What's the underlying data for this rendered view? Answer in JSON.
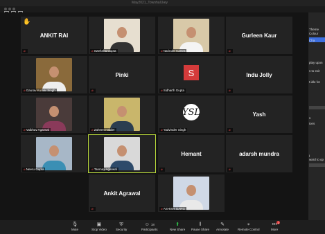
{
  "window": {
    "title": "May2021_Townhall.key"
  },
  "participants": [
    {
      "name": "ANKIT RAI",
      "display": "name",
      "muted": true,
      "raised_hand": true
    },
    {
      "name": "Sweksha Gupta",
      "display": "video",
      "muted": true
    },
    {
      "name": "Narinder Kamra",
      "display": "video",
      "muted": true
    },
    {
      "name": "Gurleen Kaur",
      "display": "name",
      "muted": true
    },
    {
      "name": "Gaurav Kumar Singh",
      "display": "video",
      "muted": true
    },
    {
      "name": "Pinki",
      "display": "name",
      "muted": true
    },
    {
      "name": "Sidharth Gupta",
      "display": "avatar",
      "avatar_letter": "S",
      "muted": true
    },
    {
      "name": "Indu Jolly",
      "display": "name",
      "muted": true
    },
    {
      "name": "Vaibhav Agarwal",
      "display": "video",
      "muted": true
    },
    {
      "name": "Zaheen Haider",
      "display": "video",
      "muted": true
    },
    {
      "name": "Yadvinder Singh",
      "display": "avatar",
      "avatar_letter": "YSL",
      "muted": true
    },
    {
      "name": "Yash",
      "display": "name",
      "muted": true
    },
    {
      "name": "Neeru Gupta",
      "display": "video",
      "muted": true
    },
    {
      "name": "Tanmay Agarwal",
      "display": "video",
      "muted": true,
      "active_speaker": true
    },
    {
      "name": "Hemant",
      "display": "name",
      "muted": true
    },
    {
      "name": "adarsh mundra",
      "display": "name",
      "muted": true
    },
    {
      "name": "Ankit Agrawal",
      "display": "name",
      "muted": true
    },
    {
      "name": "ASHISH GARG",
      "display": "video",
      "muted": true
    }
  ],
  "side_panel": {
    "items": [
      "Theme",
      "Colour",
      "Cha",
      "play upon",
      "s to exit",
      "t idle for",
      "s",
      "ions",
      "l",
      "ward to op"
    ]
  },
  "toolbar": {
    "items": [
      {
        "label": "Mute",
        "icon": "mic-icon"
      },
      {
        "label": "Stop Video",
        "icon": "video-camera-icon"
      },
      {
        "label": "Security",
        "icon": "shield-icon"
      },
      {
        "label": "Participants",
        "icon": "participants-icon",
        "count": "18"
      },
      {
        "label": "New Share",
        "icon": "share-screen-icon"
      },
      {
        "label": "Pause Share",
        "icon": "pause-icon"
      },
      {
        "label": "Annotate",
        "icon": "pen-icon"
      },
      {
        "label": "Remote Control",
        "icon": "remote-control-icon"
      },
      {
        "label": "More",
        "icon": "more-icon",
        "badge": "2"
      }
    ]
  },
  "colors": {
    "active_speaker": "#b8d83a",
    "share_green": "#2fbf4a",
    "muted_red": "#e04848",
    "avatar_red": "#d43b3b"
  }
}
